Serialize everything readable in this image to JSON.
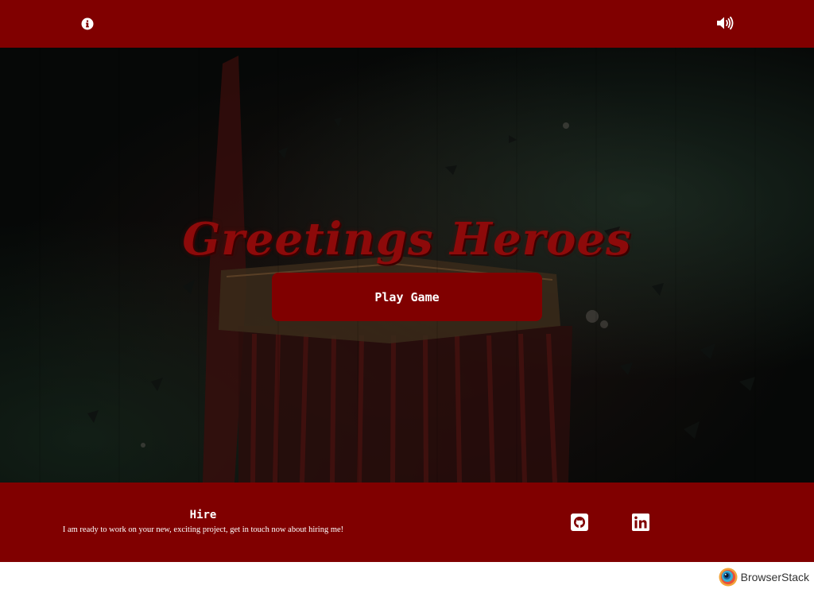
{
  "topbar": {
    "left_icon": "info-circle-icon",
    "right_icon": "volume-up-icon"
  },
  "hero": {
    "title": "Greetings Heroes",
    "play_button": "Play Game"
  },
  "footer": {
    "hire_title": "Hire",
    "hire_text": "I am ready to work on your new, exciting project, get in touch now about hiring me!",
    "social_icons": [
      "github-icon",
      "linkedin-icon"
    ]
  },
  "watermark": {
    "brand": "BrowserStack"
  },
  "colors": {
    "primary": "#800000",
    "title": "#8d0a0a",
    "background": "#050706"
  }
}
